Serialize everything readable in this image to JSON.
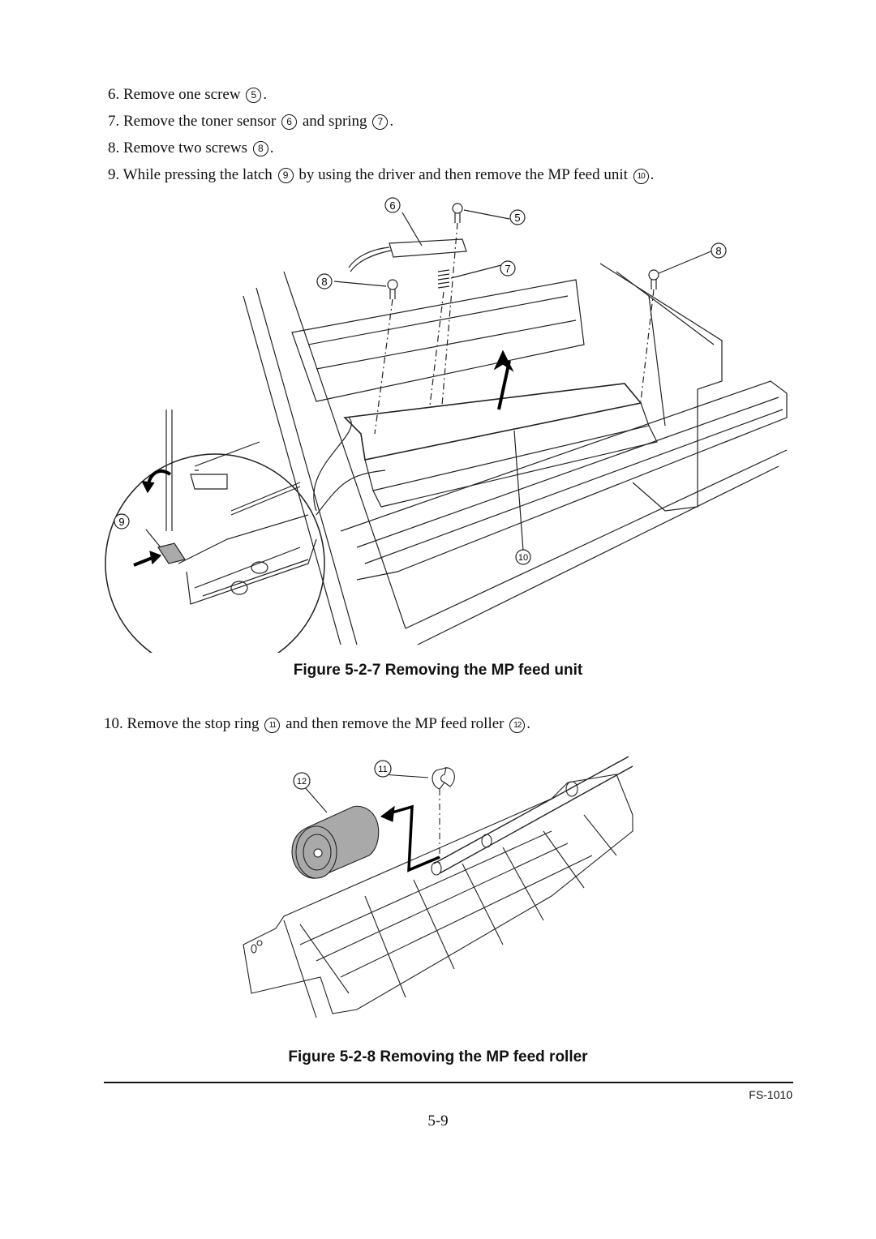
{
  "steps": [
    {
      "num": "6.",
      "before": "Remove one screw",
      "callout": "5",
      "after": "."
    },
    {
      "num": "7.",
      "before": "Remove the toner sensor",
      "callout": "6",
      "middle": "and spring",
      "callout2": "7",
      "after": "."
    },
    {
      "num": "8.",
      "before": "Remove two screws",
      "callout": "8",
      "after": "."
    },
    {
      "num": "9.",
      "before": "While pressing the latch",
      "callout": "9",
      "middle": "by using the driver and then remove the MP feed unit",
      "callout2": "10",
      "after": "."
    },
    {
      "num": "10.",
      "before": "Remove the stop ring",
      "callout": "11",
      "middle": "and then remove the MP feed roller",
      "callout2": "12",
      "after": "."
    }
  ],
  "figures": [
    {
      "caption": "Figure 5-2-7 Removing the MP feed unit",
      "callouts": [
        "6",
        "5",
        "8",
        "7",
        "8",
        "9",
        "10"
      ]
    },
    {
      "caption": "Figure 5-2-8 Removing the MP feed roller",
      "callouts": [
        "12",
        "11"
      ]
    }
  ],
  "footer": {
    "model": "FS-1010",
    "page": "5-9"
  }
}
